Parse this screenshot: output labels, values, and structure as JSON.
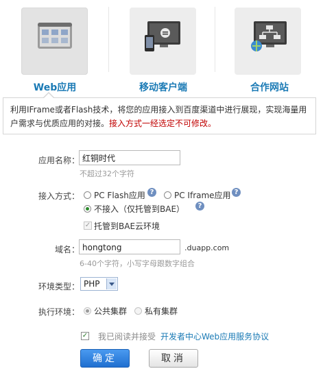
{
  "tabs": [
    {
      "label": "Web应用",
      "icon": "web-app-icon",
      "active": true
    },
    {
      "label": "移动客户端",
      "icon": "mobile-client-icon",
      "active": false
    },
    {
      "label": "合作网站",
      "icon": "partner-site-icon",
      "active": false
    }
  ],
  "description": {
    "text": "利用IFrame或者Flash技术，将您的应用接入到百度渠道中进行展现，实现海量用户需求与优质应用的对接。",
    "warning": "接入方式一经选定不可修改。"
  },
  "form": {
    "app_name": {
      "label": "应用名称：",
      "value": "红铜时代",
      "hint": "不超过32个字符"
    },
    "access": {
      "label": "接入方式：",
      "options": [
        "PC Flash应用",
        "PC Iframe应用",
        "不接入（仅托管到BAE）"
      ],
      "selected": "不接入（仅托管到BAE）",
      "host_checkbox": "托管到BAE云环境",
      "help_glyph": "?"
    },
    "domain": {
      "label": "域名：",
      "value": "hongtong",
      "suffix": ".duapp.com",
      "hint": "6-40个字符，小写字母跟数字组合"
    },
    "env_type": {
      "label": "环境类型：",
      "value": "PHP"
    },
    "exec_env": {
      "label": "执行环境：",
      "options": [
        "公共集群",
        "私有集群"
      ],
      "selected": "公共集群"
    },
    "agreement": {
      "text": "我已阅读并接受",
      "link": "开发者中心Web应用服务协议",
      "checked": true
    }
  },
  "buttons": {
    "confirm": "确定",
    "cancel": "取消"
  },
  "colors": {
    "accent": "#1a7ab5",
    "warning": "#c00000",
    "primary_button": "#1f6fd0"
  }
}
